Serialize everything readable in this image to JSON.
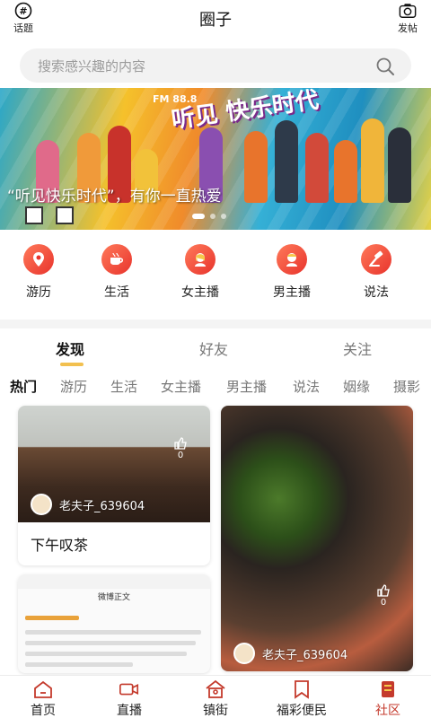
{
  "header": {
    "title": "圈子",
    "left_label": "话题",
    "right_label": "发帖"
  },
  "search": {
    "placeholder": "搜索感兴趣的内容"
  },
  "banner": {
    "fm": "FM 88.8",
    "logo": "听见 快乐时代",
    "slogan": "“听见快乐时代”，有你一直热爱"
  },
  "categories": [
    {
      "label": "游历",
      "icon": "map-pin-icon"
    },
    {
      "label": "生活",
      "icon": "coffee-cup-icon"
    },
    {
      "label": "女主播",
      "icon": "female-host-icon"
    },
    {
      "label": "男主播",
      "icon": "male-host-icon"
    },
    {
      "label": "说法",
      "icon": "gavel-icon"
    }
  ],
  "primary_tabs": [
    "发现",
    "好友",
    "关注"
  ],
  "secondary_tabs": [
    "热门",
    "游历",
    "生活",
    "女主播",
    "男主播",
    "说法",
    "姻缘",
    "摄影"
  ],
  "feed": [
    {
      "title": "下午叹茶",
      "author": "老夫子_639604",
      "likes": "0"
    },
    {
      "title": "",
      "author": "老夫子_639604",
      "likes": "0"
    },
    {
      "nav_title": "微博正文"
    }
  ],
  "bottom_nav": [
    {
      "label": "首页",
      "icon": "home-icon"
    },
    {
      "label": "直播",
      "icon": "video-camera-icon"
    },
    {
      "label": "镇街",
      "icon": "town-icon"
    },
    {
      "label": "福彩便民",
      "icon": "bookmark-icon"
    },
    {
      "label": "社区",
      "icon": "community-icon"
    }
  ],
  "colors": {
    "accent": "#c43a2c",
    "tab_indicator": "#f2c04f",
    "category_icon": "#e8332c"
  }
}
